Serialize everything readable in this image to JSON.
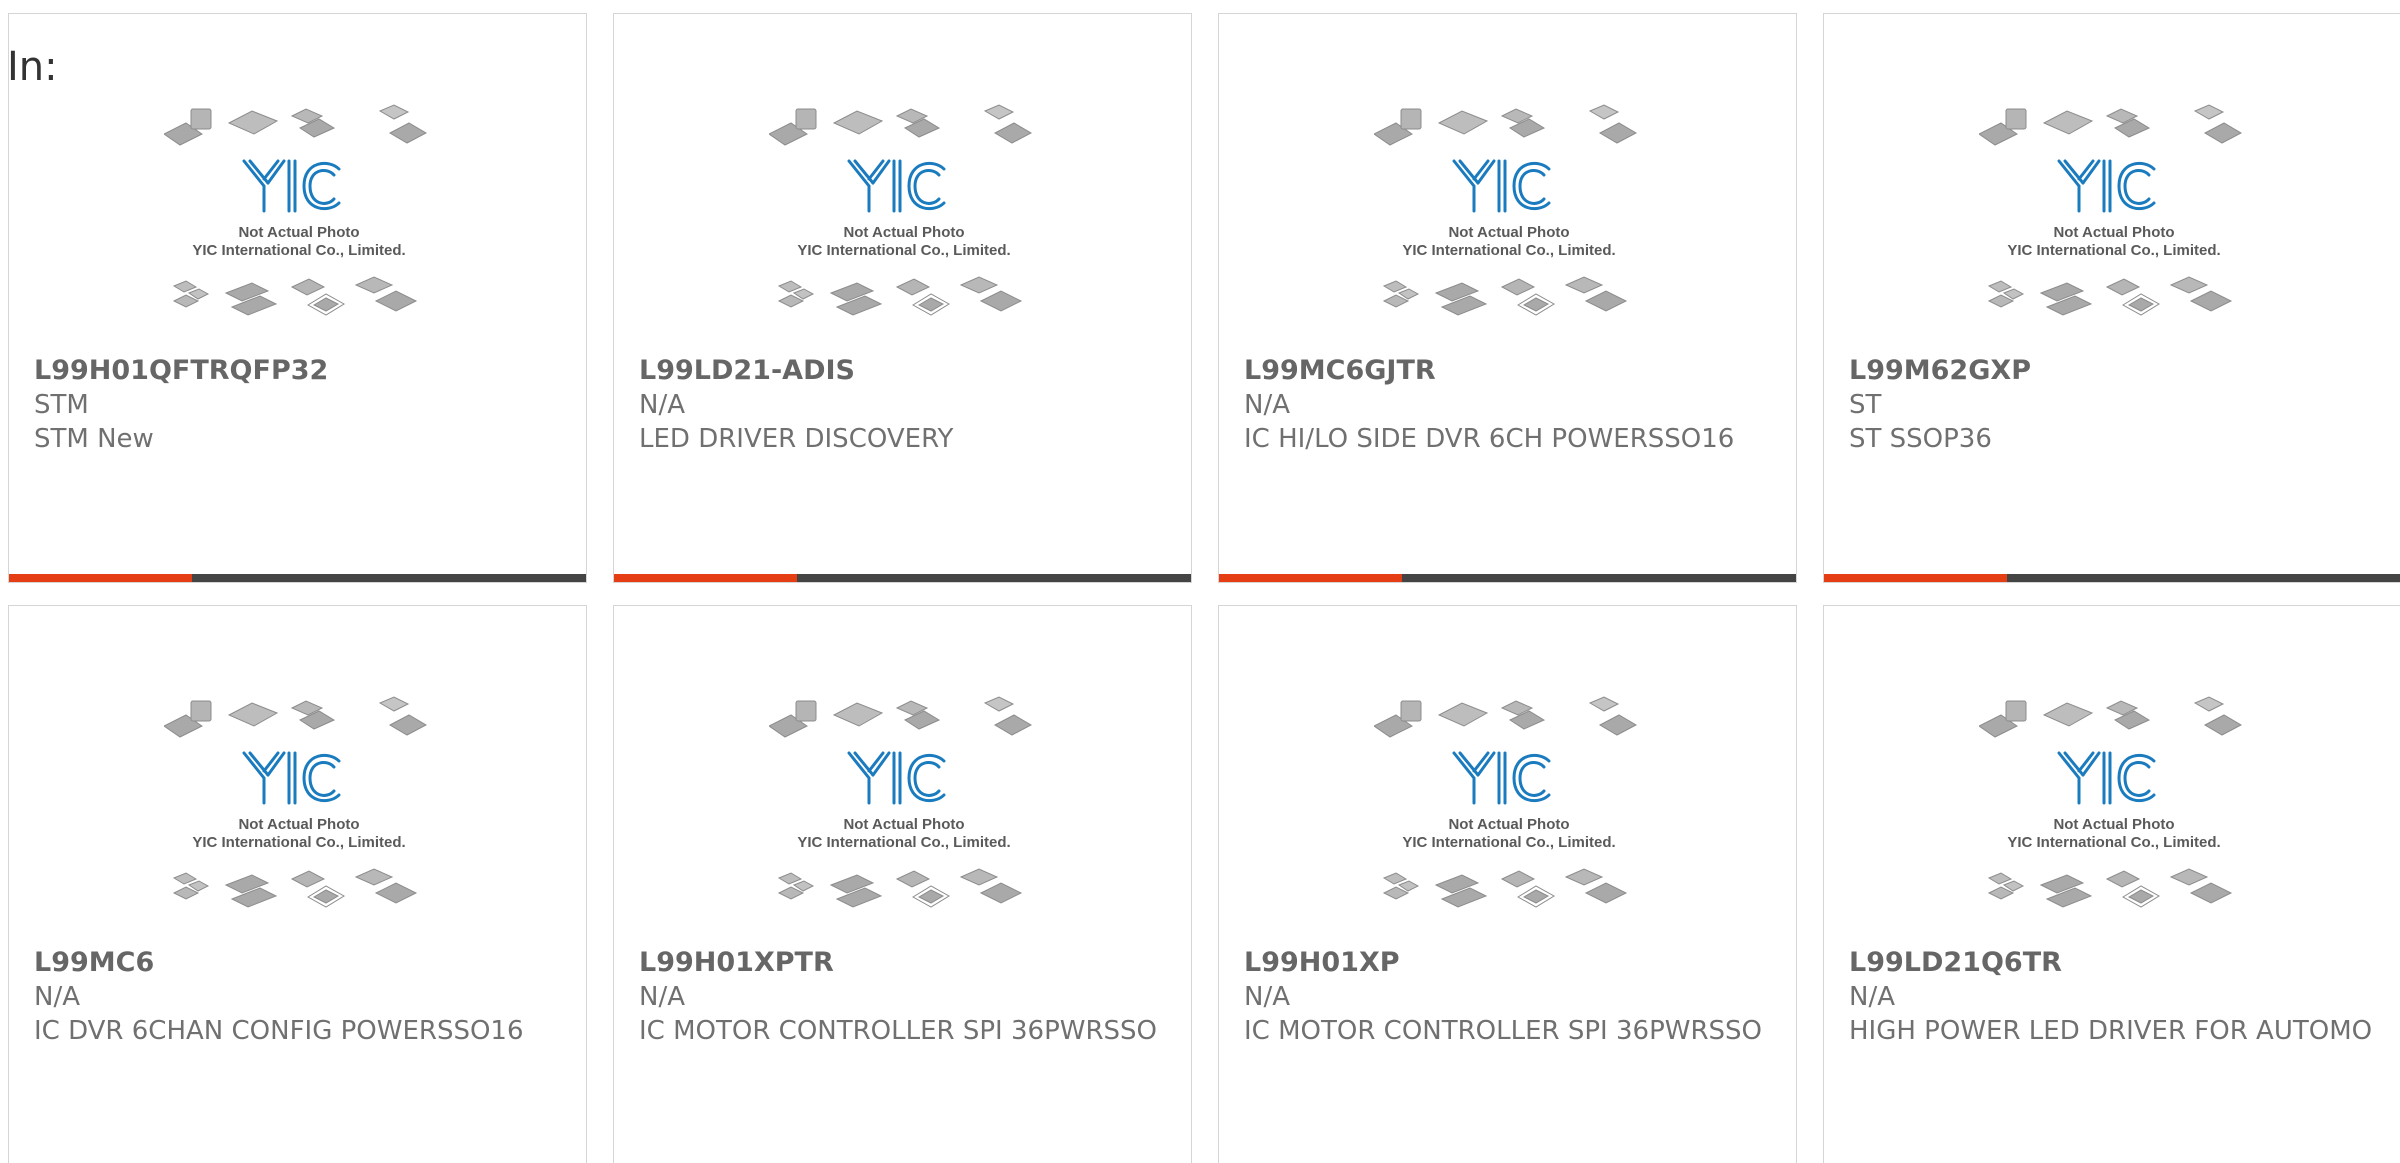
{
  "filter_label": "In:",
  "placeholder": {
    "caption_line1": "Not Actual Photo",
    "caption_line2": "YIC International Co., Limited.",
    "logo_text": "YIC",
    "logo_color": "#1a7bbf"
  },
  "accent_color": "#e63e14",
  "bar_color": "#444444",
  "products": [
    {
      "part_number": "L99H01QFTRQFP32",
      "manufacturer": "STM",
      "description": "STM New"
    },
    {
      "part_number": "L99LD21-ADIS",
      "manufacturer": "N/A",
      "description": "LED DRIVER DISCOVERY"
    },
    {
      "part_number": "L99MC6GJTR",
      "manufacturer": "N/A",
      "description": "IC HI/LO SIDE DVR 6CH POWERSSO16"
    },
    {
      "part_number": "L99M62GXP",
      "manufacturer": "ST",
      "description": "ST SSOP36"
    },
    {
      "part_number": "L99MC6",
      "manufacturer": "N/A",
      "description": "IC DVR 6CHAN CONFIG POWERSSO16"
    },
    {
      "part_number": "L99H01XPTR",
      "manufacturer": "N/A",
      "description": "IC MOTOR CONTROLLER SPI 36PWRSSO"
    },
    {
      "part_number": "L99H01XP",
      "manufacturer": "N/A",
      "description": "IC MOTOR CONTROLLER SPI 36PWRSSO"
    },
    {
      "part_number": "L99LD21Q6TR",
      "manufacturer": "N/A",
      "description": "HIGH POWER LED DRIVER FOR AUTOMO"
    }
  ]
}
